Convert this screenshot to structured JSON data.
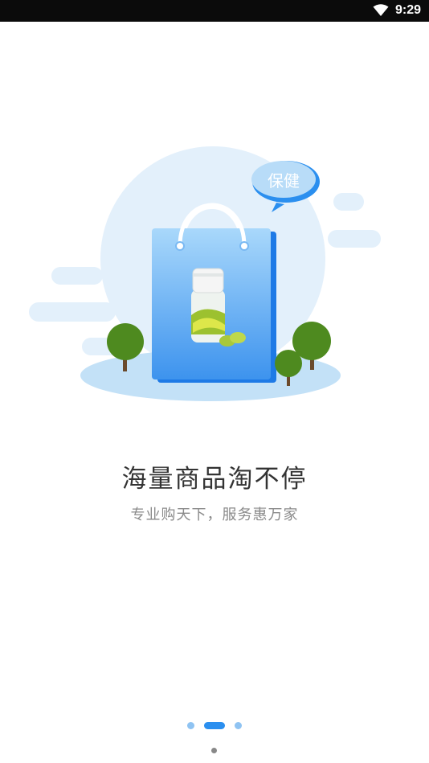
{
  "status_bar": {
    "time": "9:29",
    "wifi_icon": "wifi-icon"
  },
  "illustration": {
    "bubble_label": "保健",
    "icon": "shopping-bag-icon"
  },
  "onboarding": {
    "title": "海量商品淘不停",
    "subtitle": "专业购天下，服务惠万家",
    "page_count": 3,
    "active_page": 2
  },
  "colors": {
    "accent": "#2b8fef",
    "indicator_inactive": "#8fc3f2",
    "title": "#333333",
    "subtitle": "#8a8a8a"
  }
}
